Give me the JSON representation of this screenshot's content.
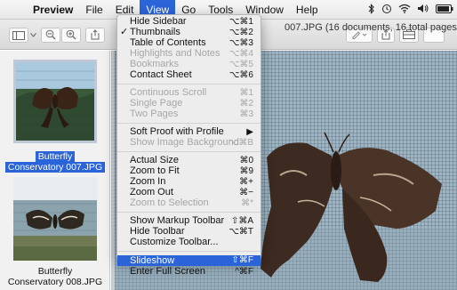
{
  "menubar": {
    "app": "Preview",
    "items": [
      "File",
      "Edit",
      "View",
      "Go",
      "Tools",
      "Window",
      "Help"
    ],
    "active": "View"
  },
  "window": {
    "title": "007.JPG (16 documents, 16 total pages)"
  },
  "sidebar": {
    "thumbs": [
      {
        "caption_line1": "Butterfly",
        "caption_line2": "Conservatory 007.JPG",
        "selected": true
      },
      {
        "caption_line1": "Butterfly",
        "caption_line2": "Conservatory 008.JPG",
        "selected": false
      }
    ]
  },
  "view_menu": {
    "groups": [
      [
        {
          "label": "Hide Sidebar",
          "shortcut": "⌥⌘1",
          "enabled": true
        },
        {
          "label": "Thumbnails",
          "shortcut": "⌥⌘2",
          "enabled": true,
          "checked": true
        },
        {
          "label": "Table of Contents",
          "shortcut": "⌥⌘3",
          "enabled": true
        },
        {
          "label": "Highlights and Notes",
          "shortcut": "⌥⌘4",
          "enabled": false
        },
        {
          "label": "Bookmarks",
          "shortcut": "⌥⌘5",
          "enabled": false
        },
        {
          "label": "Contact Sheet",
          "shortcut": "⌥⌘6",
          "enabled": true
        }
      ],
      [
        {
          "label": "Continuous Scroll",
          "shortcut": "⌘1",
          "enabled": false
        },
        {
          "label": "Single Page",
          "shortcut": "⌘2",
          "enabled": false
        },
        {
          "label": "Two Pages",
          "shortcut": "⌘3",
          "enabled": false
        }
      ],
      [
        {
          "label": "Soft Proof with Profile",
          "shortcut": "▶",
          "enabled": true
        },
        {
          "label": "Show Image Background",
          "shortcut": "⌥⌘B",
          "enabled": false
        }
      ],
      [
        {
          "label": "Actual Size",
          "shortcut": "⌘0",
          "enabled": true
        },
        {
          "label": "Zoom to Fit",
          "shortcut": "⌘9",
          "enabled": true
        },
        {
          "label": "Zoom In",
          "shortcut": "⌘+",
          "enabled": true
        },
        {
          "label": "Zoom Out",
          "shortcut": "⌘−",
          "enabled": true
        },
        {
          "label": "Zoom to Selection",
          "shortcut": "⌘*",
          "enabled": false
        }
      ],
      [
        {
          "label": "Show Markup Toolbar",
          "shortcut": "⇧⌘A",
          "enabled": true
        },
        {
          "label": "Hide Toolbar",
          "shortcut": "⌥⌘T",
          "enabled": true
        },
        {
          "label": "Customize Toolbar...",
          "shortcut": "",
          "enabled": true
        }
      ],
      [
        {
          "label": "Slideshow",
          "shortcut": "⇧⌘F",
          "enabled": true,
          "highlighted": true
        },
        {
          "label": "Enter Full Screen",
          "shortcut": "^⌘F",
          "enabled": true
        }
      ]
    ]
  },
  "colors": {
    "accent": "#2b63d8",
    "menu_bg": "#ededed",
    "disabled_text": "#a6a6a6"
  },
  "icons": {
    "apple": "apple-icon",
    "bluetooth": "bluetooth-icon",
    "time_machine": "time-machine-icon",
    "wifi": "wifi-icon",
    "volume": "volume-icon",
    "battery": "battery-icon"
  }
}
